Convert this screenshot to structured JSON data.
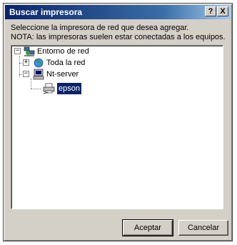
{
  "window": {
    "title": "Buscar impresora",
    "help_button": "?",
    "close_button": "X"
  },
  "info": {
    "line1": "Seleccione la impresora de red que desea agregar.",
    "line2": "NOTA: las impresoras suelen estar conectadas a los equipos."
  },
  "tree": {
    "root": {
      "label": "Entorno de red",
      "expander": "−",
      "icon": "network-neighborhood-icon"
    },
    "items": [
      {
        "label": "Toda la red",
        "expander": "+",
        "icon": "entire-network-icon"
      },
      {
        "label": "Nt-server",
        "expander": "−",
        "icon": "computer-icon"
      },
      {
        "label": "epson",
        "icon": "printer-icon",
        "selected": true
      }
    ]
  },
  "buttons": {
    "ok": "Aceptar",
    "cancel": "Cancelar"
  }
}
